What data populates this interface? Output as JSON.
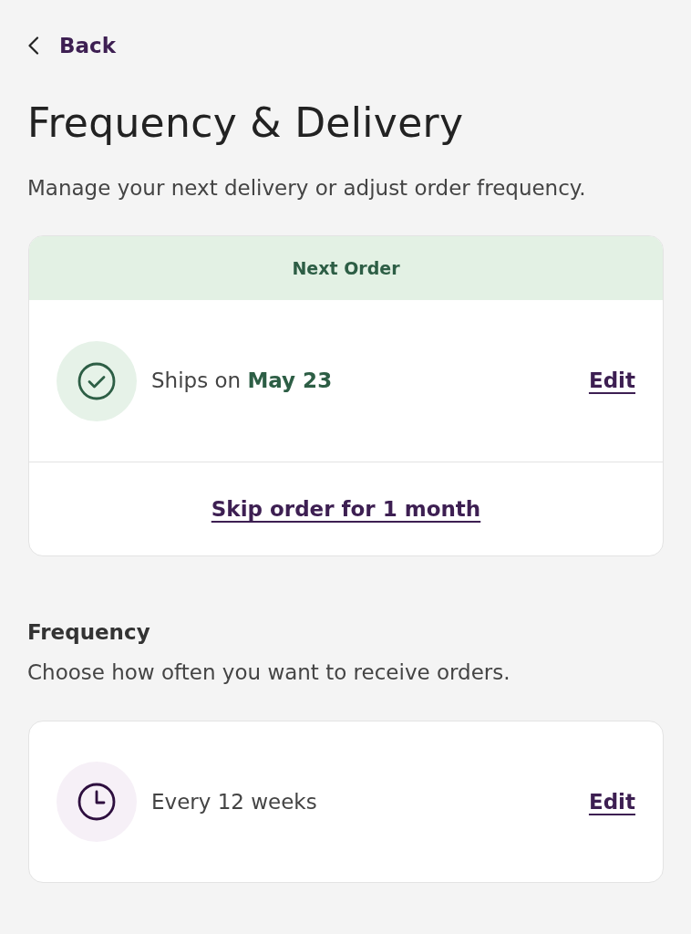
{
  "back": {
    "label": "Back"
  },
  "title": "Frequency & Delivery",
  "subtitle": "Manage your next delivery or adjust order frequency.",
  "next_order": {
    "header": "Next Order",
    "status": "Ships on **May 23**",
    "edit": "Edit",
    "skip": "Skip order for 1 month"
  },
  "frequency": {
    "heading": "Frequency",
    "description": "Choose how often you want to receive orders.",
    "value": "Every 12 weeks",
    "edit": "Edit"
  }
}
